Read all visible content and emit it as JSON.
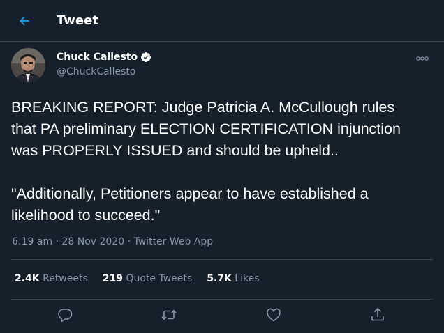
{
  "header": {
    "title": "Tweet"
  },
  "author": {
    "name": "Chuck Callesto",
    "handle": "@ChuckCallesto"
  },
  "tweet": {
    "paragraphs": [
      [
        "BREAKING REPORT:  Judge Patricia A. McCullough rules",
        "that PA preliminary ELECTION CERTIFICATION injunction",
        "was PROPERLY ISSUED and should be upheld.."
      ],
      [
        "\"Additionally, Petitioners appear to have established a",
        "likelihood to succeed.\""
      ]
    ]
  },
  "meta": {
    "time": "6:19 am",
    "separator": "·",
    "date": "28 Nov 2020",
    "source": "Twitter Web App"
  },
  "stats": {
    "retweets": {
      "count": "2.4K",
      "label": "Retweets"
    },
    "quote_tweets": {
      "count": "219",
      "label": "Quote Tweets"
    },
    "likes": {
      "count": "5.7K",
      "label": "Likes"
    }
  },
  "icons": {
    "back": "arrow-left-icon",
    "verified": "verified-badge-icon",
    "more": "more-dots-icon",
    "reply": "reply-icon",
    "retweet": "retweet-icon",
    "like": "heart-icon",
    "share": "share-icon"
  },
  "colors": {
    "background": "#15202b",
    "accent": "#1da1f2",
    "secondary_text": "#8899a6",
    "divider": "#38444d"
  }
}
